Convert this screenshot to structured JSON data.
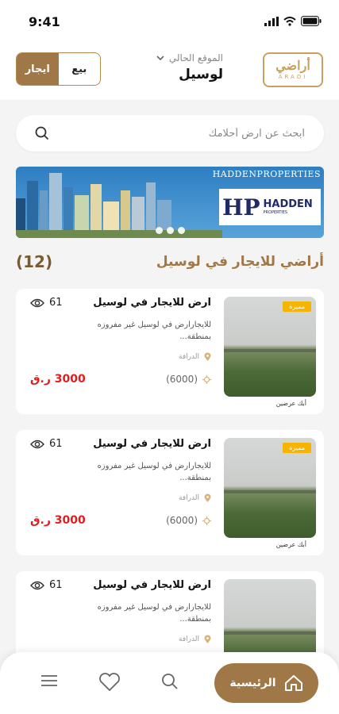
{
  "status_bar": {
    "time": "9:41"
  },
  "header": {
    "toggle": {
      "rent": "ايجار",
      "sale": "بيع"
    },
    "location_label": "الموقع الحالي",
    "location_value": "لوسيل",
    "logo_ar": "أراضي",
    "logo_en": "ARADI"
  },
  "search": {
    "placeholder": "ابحث عن ارض أحلامك"
  },
  "banner": {
    "title": "HADDENPROPERTIES",
    "brand": "HADDEN",
    "brand_mark": "HP",
    "tagline": "PROPERTIES"
  },
  "section": {
    "title": "أراضي للايجار في لوسيل",
    "count": "(12)"
  },
  "listings": [
    {
      "title": "ارض للايجار في لوسيل",
      "views": "61",
      "desc": "للايجارارض في لوسيل غير مفروزه بمنطقة...",
      "district": "الدرافة",
      "area": "(6000)",
      "price": "3000 ر.ق",
      "badge": "مميزة",
      "owner": "أبك عرضين"
    },
    {
      "title": "ارض للايجار في لوسيل",
      "views": "61",
      "desc": "للايجارارض في لوسيل غير مفروزه بمنطقة...",
      "district": "الدرافة",
      "area": "(6000)",
      "price": "3000 ر.ق",
      "badge": "مميزة",
      "owner": "أبك عرضين"
    },
    {
      "title": "ارض للايجار في لوسيل",
      "views": "61",
      "desc": "للايجارارض في لوسيل غير مفروزه بمنطقة...",
      "district": "الدرافة",
      "area": "",
      "price": "",
      "badge": "",
      "owner": ""
    }
  ],
  "bottom_nav": {
    "home": "الرئيسية"
  },
  "colors": {
    "brand": "#a07847",
    "price": "#e01c1c",
    "badge": "#f5b400"
  }
}
